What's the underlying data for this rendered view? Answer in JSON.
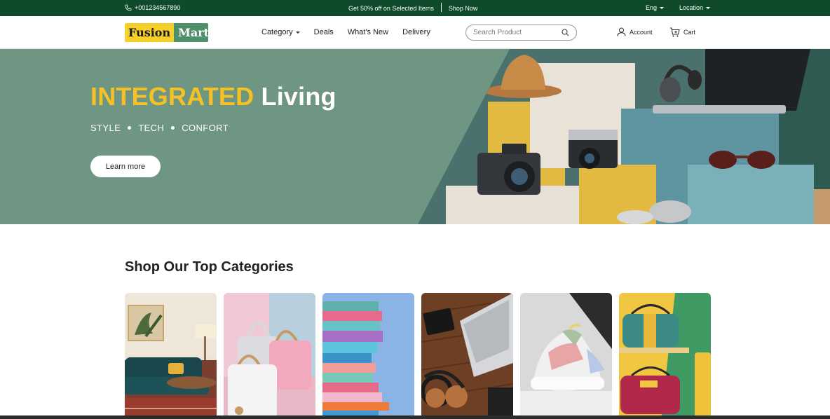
{
  "topbar": {
    "phone": "+001234567890",
    "promo": "Get 50% off on Selected Items",
    "shop_now": "Shop Now",
    "language": "Eng",
    "location": "Location"
  },
  "nav": {
    "logo_part1": "Fusion",
    "logo_part2": "Mart",
    "links": [
      "Category",
      "Deals",
      "What's New",
      "Delivery"
    ],
    "search_placeholder": "Search Product",
    "account": "Account",
    "cart": "Cart"
  },
  "hero": {
    "title_highlight": "INTEGRATED",
    "title_rest": "Living",
    "tags": [
      "STYLE",
      "TECH",
      "CONFORT"
    ],
    "button": "Learn more"
  },
  "categories": {
    "title": "Shop Our Top Categories",
    "cards": [
      "home-decor",
      "handbags",
      "books",
      "electronics",
      "sneakers",
      "travel-bags"
    ]
  },
  "colors": {
    "topbar": "#0f4a2b",
    "hero_bg": "#6f9683",
    "accent_yellow": "#f5c125",
    "logo_green": "#4f8f6a"
  }
}
